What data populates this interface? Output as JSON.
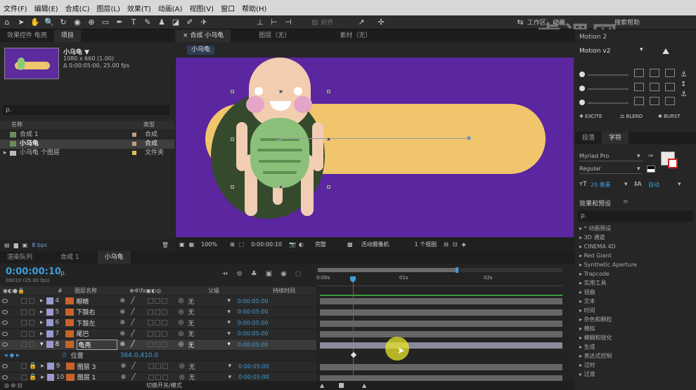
{
  "menu": [
    "文件(F)",
    "编辑(E)",
    "合成(C)",
    "图层(L)",
    "效果(T)",
    "动画(A)",
    "视图(V)",
    "窗口",
    "帮助(H)"
  ],
  "toolbar": {
    "snap_label": "对齐",
    "workspace_label": "工作区:",
    "workspace_value": "动画",
    "search_label": "搜索帮助"
  },
  "watermark": "虎课网",
  "project": {
    "tabs": [
      "效果控件 龟壳",
      "项目"
    ],
    "comp_name": "小乌龟 ▼",
    "comp_info1": "1080 x 660 (1.00)",
    "comp_info2": "Δ 0:00:05:00, 25.00 fps",
    "search_placeholder": "ρ.",
    "columns": [
      "名称",
      "类型"
    ],
    "items": [
      {
        "name": "合成 1",
        "type": "合成",
        "color": "#c0a080"
      },
      {
        "name": "小乌龟",
        "type": "合成",
        "color": "#c0a080"
      },
      {
        "name": "小乌龟 个图层",
        "type": "文件夹",
        "color": "#e0c050"
      }
    ],
    "bpc": "8 bpc"
  },
  "viewer": {
    "tabs": [
      "合成 小乌龟",
      "图层（无）",
      "素材（无）"
    ],
    "comp_tag": "小乌龟",
    "zoom": "100%",
    "timecode": "0:00:00:10",
    "quality": "完整",
    "camera": "活动摄像机",
    "views": "1 个视图"
  },
  "timeline": {
    "tabs": [
      "渲染队列",
      "合成 1",
      "小乌龟"
    ],
    "timecode": "0:00:00:10",
    "sub_timecode": "00010 (25.00 fps)",
    "headers": {
      "name": "图层名称",
      "parent": "父级",
      "duration": "持续时间"
    },
    "ruler": [
      "0:00s",
      "01s",
      "02s"
    ],
    "layers": [
      {
        "num": "4",
        "name": "眼睛",
        "parent": "无",
        "dur": "0:00:05:00",
        "color": "#9a9ad0"
      },
      {
        "num": "5",
        "name": "下鼓右",
        "parent": "无",
        "dur": "0:00:05:00",
        "color": "#9a9ad0"
      },
      {
        "num": "6",
        "name": "下鼓左",
        "parent": "无",
        "dur": "0:00:05:00",
        "color": "#9a9ad0"
      },
      {
        "num": "7",
        "name": "尾巴",
        "parent": "无",
        "dur": "0:00:05:00",
        "color": "#9a9ad0"
      },
      {
        "num": "8",
        "name": "龟壳",
        "parent": "无",
        "dur": "0:00:05:00",
        "color": "#9a9ad0"
      }
    ],
    "prop_name": "位置",
    "prop_value": "364.0,410.0",
    "layers2": [
      {
        "num": "9",
        "name": "图层 3",
        "parent": "无",
        "dur": "0:00:05:00",
        "color": "#9a9ad0"
      },
      {
        "num": "10",
        "name": "图层 1",
        "parent": "无",
        "dur": "0:00:05:00",
        "color": "#9a9ad0"
      }
    ],
    "switch_label": "切换开关/模式"
  },
  "motion": {
    "title": "Motion 2",
    "version": "Motion v2",
    "buttons": [
      "EXCITE",
      "BLEND",
      "BURST"
    ]
  },
  "char": {
    "tabs": [
      "段落",
      "字符"
    ],
    "font": "Myriad Pro",
    "style": "Regular",
    "size": "20 像素",
    "leading": "自动"
  },
  "effects": {
    "title": "效果和预设",
    "search": "ρ.",
    "items": [
      "* 动画预设",
      "3D 通道",
      "CINEMA 4D",
      "Red Giant",
      "Synthetic Aperture",
      "Trapcode",
      "实用工具",
      "扭曲",
      "文本",
      "时间",
      "杂色和颗粒",
      "模拟",
      "模糊和锐化",
      "生成",
      "表达式控制",
      "过时",
      "过渡"
    ]
  }
}
